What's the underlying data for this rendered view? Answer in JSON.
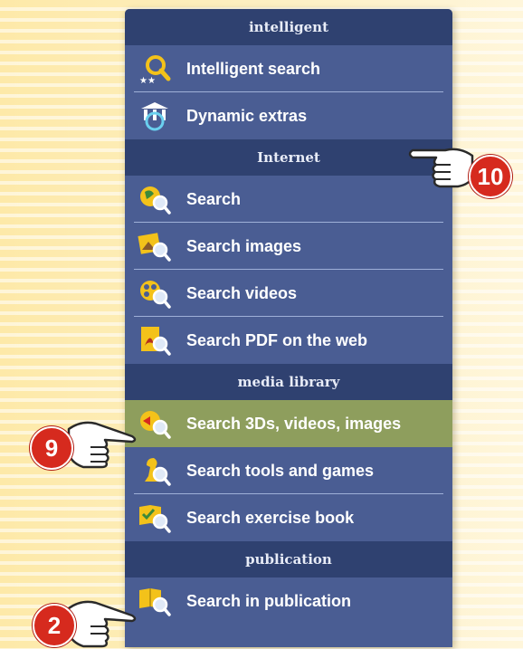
{
  "menu": {
    "sections": [
      {
        "header": "intelligent",
        "items": [
          {
            "label": "Intelligent search",
            "icon": "intelligent-search-icon"
          },
          {
            "label": "Dynamic extras",
            "icon": "dynamic-extras-icon"
          }
        ]
      },
      {
        "header": "Internet",
        "items": [
          {
            "label": "Search",
            "icon": "web-search-icon"
          },
          {
            "label": "Search images",
            "icon": "search-images-icon"
          },
          {
            "label": "Search videos",
            "icon": "search-videos-icon"
          },
          {
            "label": "Search PDF on the web",
            "icon": "search-pdf-icon"
          }
        ]
      },
      {
        "header": "media library",
        "items": [
          {
            "label": "Search 3Ds, videos, images",
            "icon": "search-media-icon",
            "active": true
          },
          {
            "label": "Search tools and games",
            "icon": "search-tools-games-icon"
          },
          {
            "label": "Search exercise book",
            "icon": "search-exercise-book-icon"
          }
        ]
      },
      {
        "header": "publication",
        "items": [
          {
            "label": "Search in publication",
            "icon": "search-publication-icon"
          }
        ]
      }
    ]
  },
  "callouts": [
    {
      "number": "10",
      "target": "Internet"
    },
    {
      "number": "9",
      "target": "Search 3Ds, videos, images"
    },
    {
      "number": "2",
      "target": "Search in publication"
    }
  ],
  "colors": {
    "header_bg": "#2f4170",
    "item_bg": "#4a5d93",
    "active_bg": "#8e9e5d",
    "badge": "#d62a1e"
  }
}
